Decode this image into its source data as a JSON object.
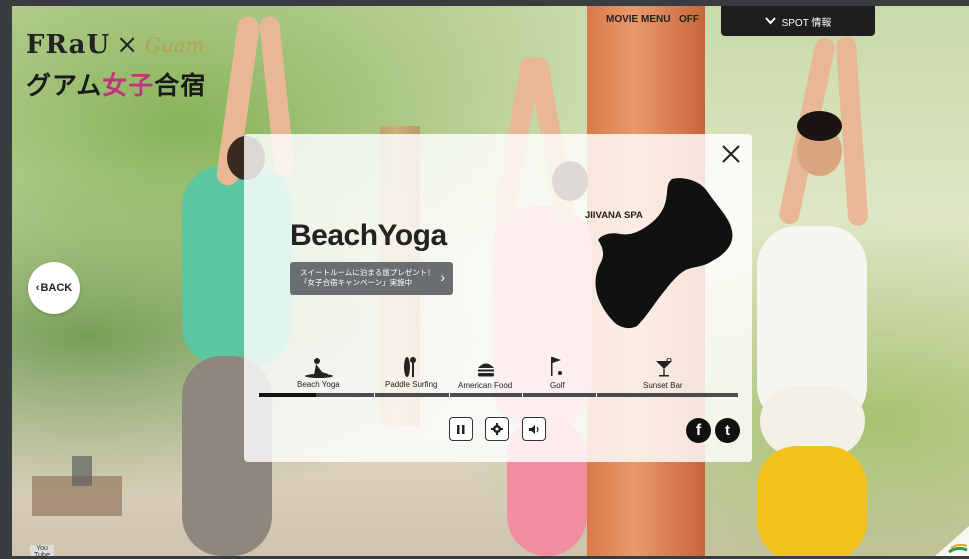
{
  "brand": {
    "frau": "FRaU",
    "cross": "×",
    "guam": "Guam",
    "subtitle_before": "グアム",
    "subtitle_highlight": "女子",
    "subtitle_after": "合宿"
  },
  "top_bar": {
    "movie_menu_label": "MOVIE MENU",
    "movie_menu_state": "OFF",
    "spot_button_label": "SPOT 情報"
  },
  "back_button_label": "BACK",
  "panel": {
    "title": "BeachYoga",
    "promo_line1": "スイートルームに泊まる旅プレゼント！",
    "promo_line2": "「女子合宿キャンペーン」実施中",
    "spot_name": "JIIVANA SPA",
    "nav_items": [
      {
        "label": "Beach Yoga",
        "icon": "yoga-icon"
      },
      {
        "label": "Paddle Surfing",
        "icon": "surfboard-icon"
      },
      {
        "label": "American Food",
        "icon": "burger-icon"
      },
      {
        "label": "Golf",
        "icon": "golf-flag-icon"
      },
      {
        "label": "Sunset Bar",
        "icon": "cocktail-icon"
      }
    ],
    "progress_fraction": 0.12
  },
  "colors": {
    "accent_pink": "#c2357a",
    "dark": "#1e1e1e",
    "promo_bg": "#6b6e70"
  },
  "bottom": {
    "youtube_label": "You Tube"
  }
}
